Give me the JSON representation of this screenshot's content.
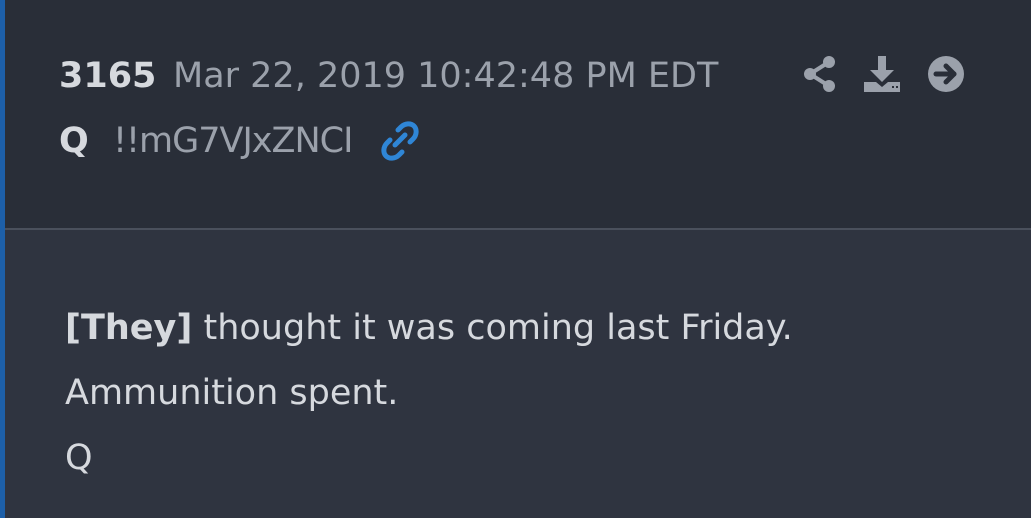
{
  "post": {
    "number": "3165",
    "timestamp": "Mar 22, 2019 10:42:48 PM EDT",
    "author": "Q",
    "tripcode": "!!mG7VJxZNCI"
  },
  "icons": {
    "share": "share-icon",
    "download": "download-icon",
    "navigate": "arrow-right-circle-icon",
    "link": "link-icon"
  },
  "message": {
    "lines": [
      {
        "bold_prefix": "[They]",
        "text": " thought it was coming last Friday."
      },
      {
        "bold_prefix": "",
        "text": "Ammunition spent."
      },
      {
        "bold_prefix": "",
        "text": "Q"
      }
    ]
  },
  "colors": {
    "accent_border": "#1d5fa8",
    "link_blue": "#2f86d6",
    "header_bg": "#292e38",
    "body_bg": "#2f3440",
    "text_primary": "#d6d9de",
    "text_secondary": "#9ba1ab"
  }
}
